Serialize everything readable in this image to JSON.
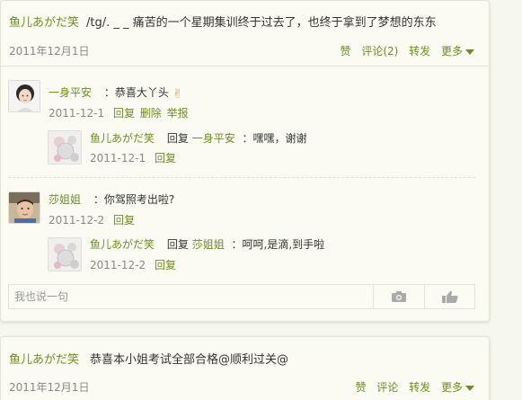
{
  "post1": {
    "author": "鱼儿あがだ笑",
    "text": "/tg/. _ _ 痛苦的一个星期集训终于过去了，也终于拿到了梦想的东东",
    "date": "2011年12月1日",
    "actions": {
      "like": "赞",
      "comment": "评论(2)",
      "forward": "转发",
      "more": "更多"
    },
    "comments": [
      {
        "author": "一身平安",
        "text": "：恭喜大丫头",
        "emoji": "✌",
        "date": "2011-12-1",
        "reply": "回复",
        "delete": "删除",
        "report": "举报",
        "replies": [
          {
            "author": "鱼儿あがだ笑",
            "reply_word": "回复",
            "target": "一身平安",
            "text": "：嘿嘿，谢谢",
            "date": "2011-12-1",
            "reply": "回复"
          }
        ]
      },
      {
        "author": "莎姐姐",
        "text": "：你驾照考出啦?",
        "date": "2011-12-2",
        "reply": "回复",
        "replies": [
          {
            "author": "鱼儿あがだ笑",
            "reply_word": "回复",
            "target": "莎姐姐",
            "text": "：呵呵,是滴,到手啦",
            "date": "2011-12-2",
            "reply": "回复"
          }
        ]
      }
    ],
    "input_placeholder": "我也说一句",
    "camera_icon": "camera-icon",
    "thumb_icon": "thumbs-up-icon"
  },
  "post2": {
    "author": "鱼儿あがだ笑",
    "text": "恭喜本小姐考试全部合格@顺利过关@",
    "date": "2011年12月1日",
    "actions": {
      "like": "赞",
      "comment": "评论",
      "forward": "转发",
      "more": "更多"
    }
  },
  "colors": {
    "accent": "#6b8e23",
    "background": "#f6f7ee",
    "card": "#fbfbf3",
    "muted": "#888888"
  }
}
